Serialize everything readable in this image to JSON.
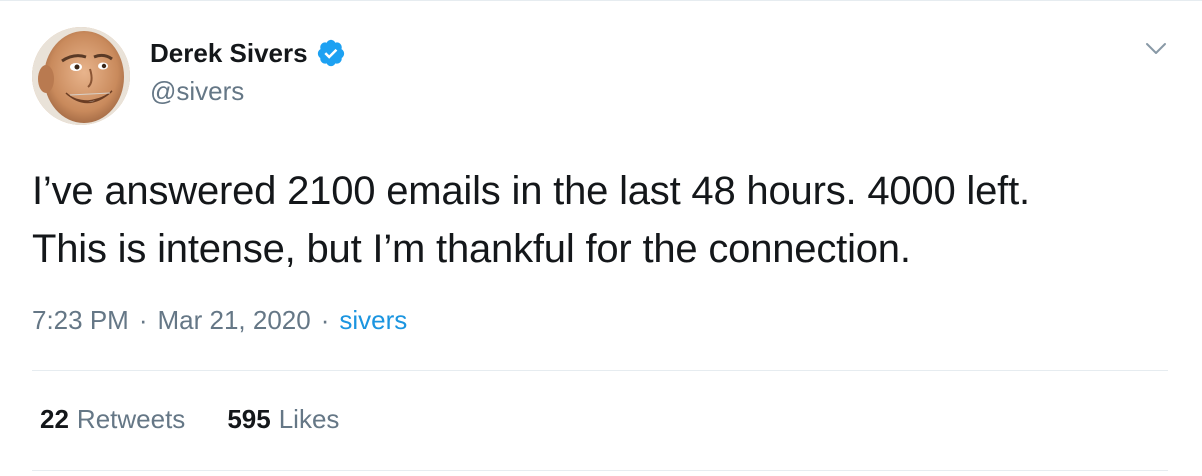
{
  "author": {
    "display_name": "Derek Sivers",
    "handle": "@sivers",
    "verified": true
  },
  "tweet": {
    "text_line1": "I’ve answered 2100 emails in the last 48 hours. 4000 left.",
    "text_line2": "This is intense, but I’m thankful for the connection."
  },
  "meta": {
    "time": "7:23 PM",
    "date": "Mar 21, 2020",
    "separator": "·",
    "source": "sivers"
  },
  "stats": {
    "retweets_count": "22",
    "retweets_label": "Retweets",
    "likes_count": "595",
    "likes_label": "Likes"
  },
  "colors": {
    "verified": "#1da1f2",
    "link": "#1b95e0",
    "secondary_text": "#657786",
    "primary_text": "#14171a",
    "divider": "#e6ecf0"
  },
  "icons": {
    "verified": "verified-badge-icon",
    "menu": "chevron-down-icon"
  }
}
